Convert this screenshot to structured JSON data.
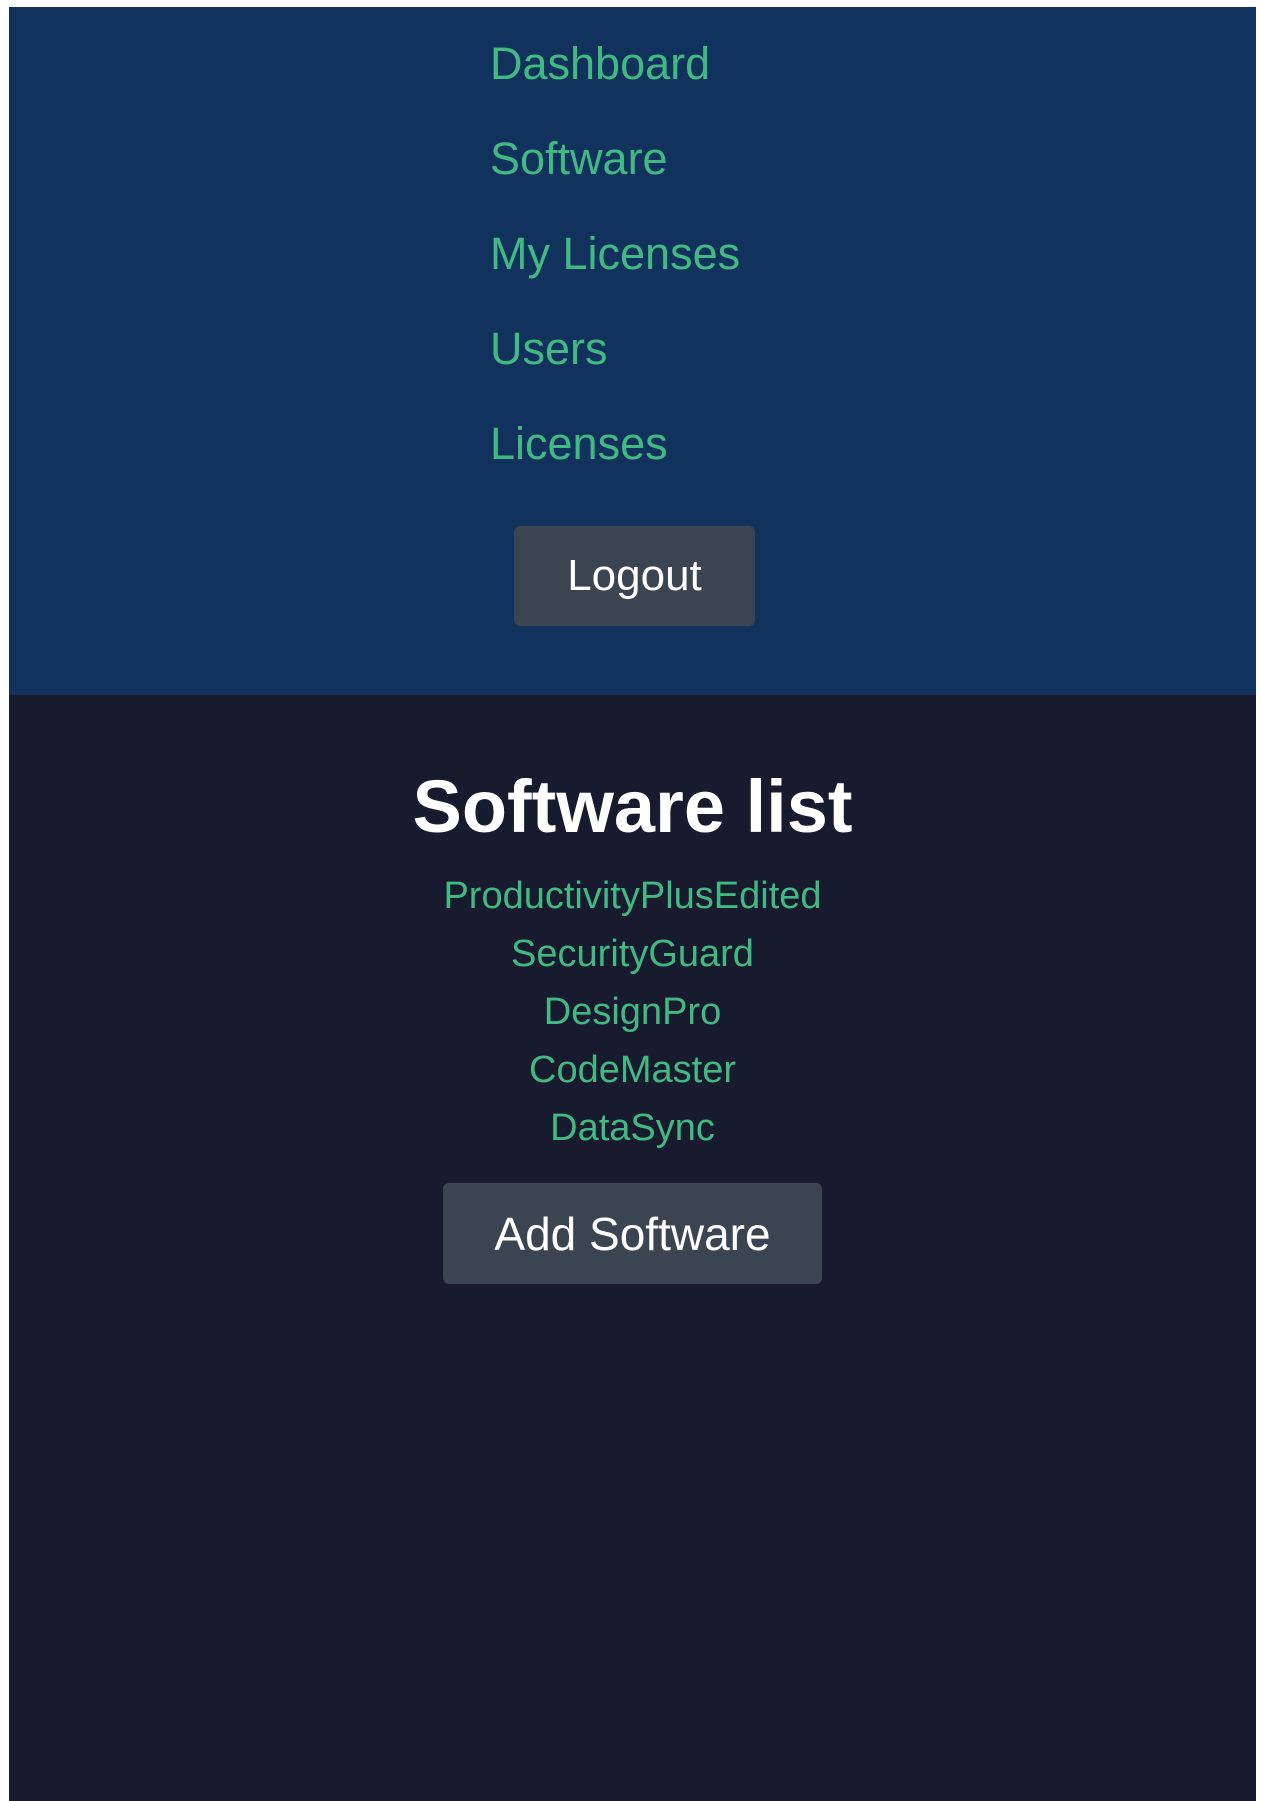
{
  "nav": {
    "items": [
      {
        "label": "Dashboard"
      },
      {
        "label": "Software"
      },
      {
        "label": "My Licenses"
      },
      {
        "label": "Users"
      },
      {
        "label": "Licenses"
      }
    ],
    "logout_label": "Logout"
  },
  "main": {
    "title": "Software list",
    "software": [
      {
        "name": "ProductivityPlusEdited"
      },
      {
        "name": "SecurityGuard"
      },
      {
        "name": "DesignPro"
      },
      {
        "name": "CodeMaster"
      },
      {
        "name": "DataSync"
      }
    ],
    "add_label": "Add Software"
  },
  "colors": {
    "nav_background": "#10325c",
    "page_background": "#181a2d",
    "link": "#42b883",
    "button_background": "#3b4552",
    "button_text": "#ffffff"
  }
}
